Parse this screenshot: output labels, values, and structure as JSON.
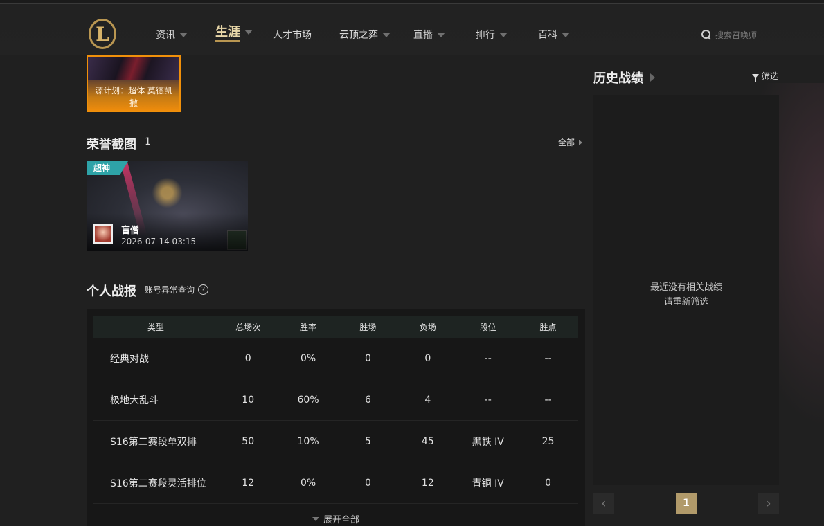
{
  "nav": {
    "logo_letter": "L",
    "items": [
      {
        "label": "资讯"
      },
      {
        "label": "生涯"
      },
      {
        "label": "人才市场"
      },
      {
        "label": "云顶之弈"
      },
      {
        "label": "直播"
      },
      {
        "label": "排行"
      },
      {
        "label": "百科"
      }
    ],
    "search_placeholder": "搜索召唤师"
  },
  "skin_card": {
    "name": "源计划：超体 莫德凯撒"
  },
  "honor": {
    "title": "荣誉截图",
    "count": "1",
    "more": "全部",
    "item": {
      "badge": "超神",
      "user": "盲僧",
      "time": "2026-07-14 03:15"
    }
  },
  "stats": {
    "title": "个人战报",
    "account_check": "账号异常查询",
    "help_icon_text": "?",
    "headers": [
      "类型",
      "总场次",
      "胜率",
      "胜场",
      "负场",
      "段位",
      "胜点"
    ],
    "rows": [
      [
        "经典对战",
        "0",
        "0%",
        "0",
        "0",
        "--",
        "--"
      ],
      [
        "极地大乱斗",
        "10",
        "60%",
        "6",
        "4",
        "--",
        "--"
      ],
      [
        "S16第二赛段单双排",
        "50",
        "10%",
        "5",
        "45",
        "黑铁 IV",
        "25"
      ],
      [
        "S16第二赛段灵活排位",
        "12",
        "0%",
        "0",
        "12",
        "青铜 IV",
        "0"
      ]
    ],
    "expand": "展开全部"
  },
  "history": {
    "title": "历史战绩",
    "filter": "筛选",
    "empty_line1": "最近没有相关战绩",
    "empty_line2": "请重新筛选",
    "page": "1",
    "prev": "‹",
    "next": "›"
  },
  "colors": {
    "accent_gold": "#b99651",
    "badge_teal": "#2ea3a8",
    "skin_orange": "#f0900a"
  }
}
